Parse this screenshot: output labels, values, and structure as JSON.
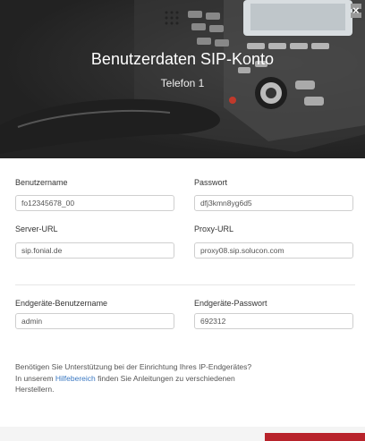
{
  "header": {
    "title": "Benutzerdaten SIP-Konto",
    "subtitle": "Telefon 1",
    "close_glyph": "×"
  },
  "fields": {
    "username": {
      "label": "Benutzername",
      "value": "fo12345678_00"
    },
    "password": {
      "label": "Passwort",
      "value": "dfj3kmn8yg6d5"
    },
    "server": {
      "label": "Server-URL",
      "value": "sip.fonial.de"
    },
    "proxy": {
      "label": "Proxy-URL",
      "value": "proxy08.sip.solucon.com"
    },
    "device_user": {
      "label": "Endgeräte-Benutzername",
      "value": "admin"
    },
    "device_pass": {
      "label": "Endgeräte-Passwort",
      "value": "692312"
    }
  },
  "help": {
    "line1": "Benötigen Sie Unterstützung bei der Einrichtung Ihres IP-Endgerätes?",
    "pre_link": "In unserem ",
    "link": "Hilfebereich",
    "post_link": " finden Sie Anleitungen zu verschiedenen",
    "line3": "Herstellern."
  },
  "colors": {
    "accent": "#b8232b",
    "link": "#3a78c2"
  }
}
